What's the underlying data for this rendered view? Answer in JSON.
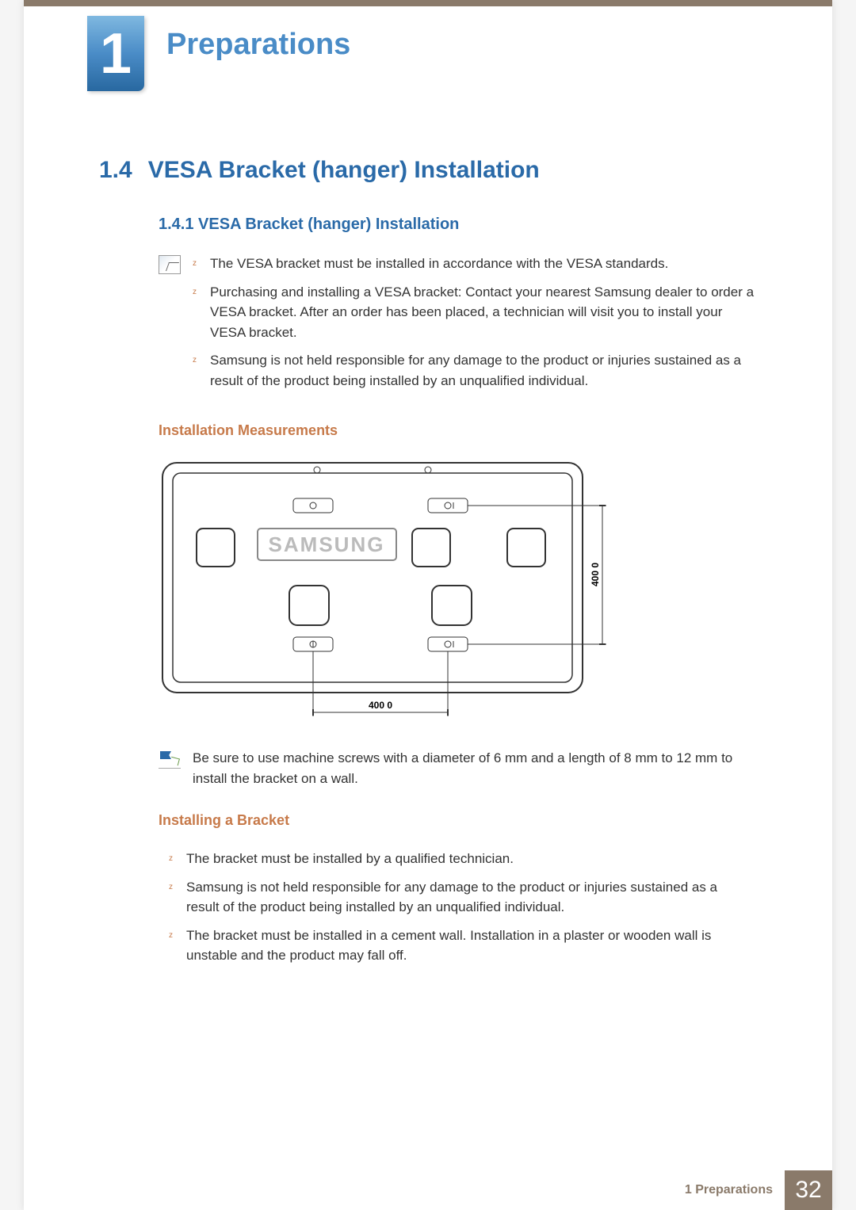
{
  "chapter": {
    "number": "1",
    "title": "Preparations"
  },
  "section": {
    "number": "1.4",
    "title": "VESA Bracket (hanger) Installation"
  },
  "subsection": {
    "number": "1.4.1",
    "title": "VESA Bracket (hanger) Installation"
  },
  "note1": {
    "items": [
      "The VESA bracket must be installed in accordance with the VESA standards.",
      "Purchasing and installing a VESA bracket: Contact your nearest Samsung dealer to order a VESA bracket. After an order has been placed, a technician will visit you to install your VESA bracket.",
      "Samsung is not held responsible for any damage to the product or injuries sustained as a result of the product being installed by an unqualified individual."
    ]
  },
  "heading_measurements": "Installation Measurements",
  "diagram": {
    "brand": "SAMSUNG",
    "dim_h": "400  0",
    "dim_v": "400  0"
  },
  "note2": {
    "text": "Be sure to use machine screws with a diameter of 6 mm and a length of 8 mm to 12 mm to install the bracket on a wall."
  },
  "heading_installing": "Installing a Bracket",
  "installing_items": [
    "The bracket must be installed by a qualified technician.",
    "Samsung is not held responsible for any damage to the product or injuries sustained as a result of the product being installed by an unqualified individual.",
    "The bracket must be installed in a cement wall. Installation in a plaster or wooden wall is unstable and the product may fall off."
  ],
  "footer": {
    "label": "1 Preparations",
    "page": "32"
  }
}
